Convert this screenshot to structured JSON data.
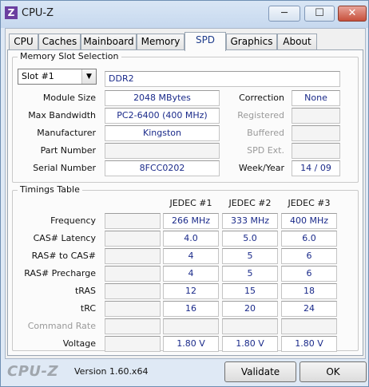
{
  "window": {
    "title": "CPU-Z",
    "icon_letter": "Z",
    "minimize": "─",
    "maximize": "☐",
    "close": "✕"
  },
  "tabs": [
    {
      "label": "CPU",
      "active": false
    },
    {
      "label": "Caches",
      "active": false
    },
    {
      "label": "Mainboard",
      "active": false
    },
    {
      "label": "Memory",
      "active": false
    },
    {
      "label": "SPD",
      "active": true
    },
    {
      "label": "Graphics",
      "active": false
    },
    {
      "label": "About",
      "active": false
    }
  ],
  "slot": {
    "group_title": "Memory Slot Selection",
    "selected": "Slot #1",
    "type": "DDR2",
    "module_size_label": "Module Size",
    "module_size": "2048 MBytes",
    "max_bandwidth_label": "Max Bandwidth",
    "max_bandwidth": "PC2-6400 (400 MHz)",
    "manufacturer_label": "Manufacturer",
    "manufacturer": "Kingston",
    "part_number_label": "Part Number",
    "part_number": "",
    "serial_number_label": "Serial Number",
    "serial_number": "8FCC0202",
    "correction_label": "Correction",
    "correction": "None",
    "registered_label": "Registered",
    "registered": "",
    "buffered_label": "Buffered",
    "buffered": "",
    "spd_ext_label": "SPD Ext.",
    "spd_ext": "",
    "week_year_label": "Week/Year",
    "week_year": "14 / 09"
  },
  "timings": {
    "group_title": "Timings Table",
    "columns": [
      "JEDEC #1",
      "JEDEC #2",
      "JEDEC #3"
    ],
    "rows": [
      {
        "label": "Frequency",
        "values": [
          "266 MHz",
          "333 MHz",
          "400 MHz"
        ],
        "grey": false
      },
      {
        "label": "CAS# Latency",
        "values": [
          "4.0",
          "5.0",
          "6.0"
        ],
        "grey": false
      },
      {
        "label": "RAS# to CAS#",
        "values": [
          "4",
          "5",
          "6"
        ],
        "grey": false
      },
      {
        "label": "RAS# Precharge",
        "values": [
          "4",
          "5",
          "6"
        ],
        "grey": false
      },
      {
        "label": "tRAS",
        "values": [
          "12",
          "15",
          "18"
        ],
        "grey": false
      },
      {
        "label": "tRC",
        "values": [
          "16",
          "20",
          "24"
        ],
        "grey": false
      },
      {
        "label": "Command Rate",
        "values": [
          "",
          "",
          ""
        ],
        "grey": true
      },
      {
        "label": "Voltage",
        "values": [
          "1.80 V",
          "1.80 V",
          "1.80 V"
        ],
        "grey": false
      }
    ]
  },
  "footer": {
    "brand": "CPU-Z",
    "version": "Version 1.60.x64",
    "validate_label": "Validate",
    "ok_label": "OK"
  }
}
